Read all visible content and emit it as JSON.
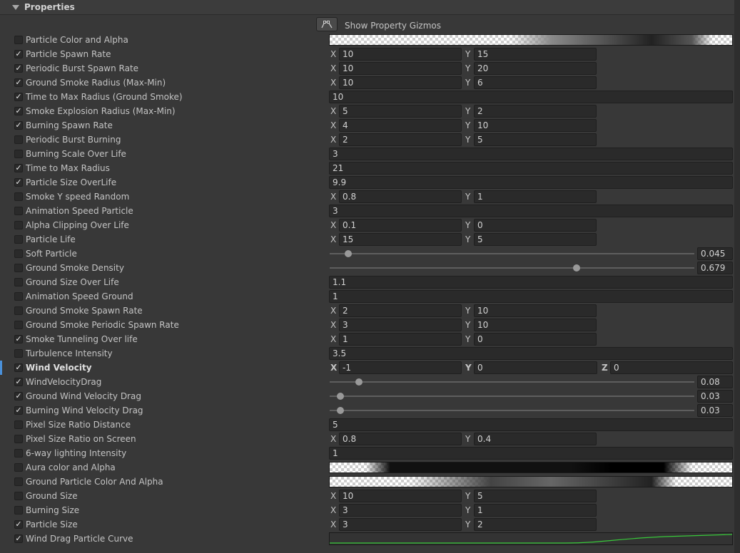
{
  "header": {
    "title": "Properties"
  },
  "gizmo": {
    "label": "Show Property Gizmos",
    "icon": "gizmo-icon"
  },
  "colors": {
    "accent": "#4a90d9",
    "curve": "#38c93a",
    "check": "#e6e6e6"
  },
  "rows": [
    {
      "label": "Particle Color and Alpha",
      "checked": false,
      "type": "gradient",
      "gradient": "a"
    },
    {
      "label": "Particle Spawn Rate",
      "checked": true,
      "type": "xy",
      "x": "10",
      "y": "15"
    },
    {
      "label": "Periodic Burst Spawn Rate",
      "checked": true,
      "type": "xy",
      "x": "10",
      "y": "20"
    },
    {
      "label": "Ground Smoke Radius (Max-Min)",
      "checked": true,
      "type": "xy",
      "x": "10",
      "y": "6"
    },
    {
      "label": "Time to Max Radius (Ground Smoke)",
      "checked": true,
      "type": "float",
      "value": "10"
    },
    {
      "label": "Smoke Explosion Radius (Max-Min)",
      "checked": true,
      "type": "xy",
      "x": "5",
      "y": "2"
    },
    {
      "label": "Burning Spawn Rate",
      "checked": true,
      "type": "xy",
      "x": "4",
      "y": "10"
    },
    {
      "label": "Periodic Burst Burning",
      "checked": false,
      "type": "xy",
      "x": "2",
      "y": "5"
    },
    {
      "label": "Burning Scale Over Life",
      "checked": false,
      "type": "float",
      "value": "3"
    },
    {
      "label": "Time to Max Radius",
      "checked": true,
      "type": "float",
      "value": "21"
    },
    {
      "label": "Particle Size OverLife",
      "checked": true,
      "type": "float",
      "value": "9.9"
    },
    {
      "label": "Smoke Y speed Random",
      "checked": false,
      "type": "xy",
      "x": "0.8",
      "y": "1"
    },
    {
      "label": "Animation Speed Particle",
      "checked": false,
      "type": "float",
      "value": "3"
    },
    {
      "label": "Alpha Clipping Over Life",
      "checked": false,
      "type": "xy",
      "x": "0.1",
      "y": "0"
    },
    {
      "label": "Particle Life",
      "checked": false,
      "type": "xy",
      "x": "15",
      "y": "5"
    },
    {
      "label": "Soft Particle",
      "checked": false,
      "type": "slider",
      "value": "0.045",
      "fraction": 0.05
    },
    {
      "label": "Ground Smoke Density",
      "checked": false,
      "type": "slider",
      "value": "0.679",
      "fraction": 0.678
    },
    {
      "label": "Ground Size Over Life",
      "checked": false,
      "type": "float",
      "value": "1.1"
    },
    {
      "label": "Animation Speed Ground",
      "checked": false,
      "type": "float",
      "value": "1"
    },
    {
      "label": "Ground Smoke Spawn Rate",
      "checked": false,
      "type": "xy",
      "x": "2",
      "y": "10"
    },
    {
      "label": "Ground Smoke Periodic Spawn Rate",
      "checked": false,
      "type": "xy",
      "x": "3",
      "y": "10"
    },
    {
      "label": "Smoke Tunneling Over life",
      "checked": true,
      "type": "xy",
      "x": "1",
      "y": "0"
    },
    {
      "label": "Turbulence Intensity",
      "checked": false,
      "type": "float",
      "value": "3.5"
    },
    {
      "label": "Wind Velocity",
      "checked": true,
      "type": "xyz",
      "x": "-1",
      "y": "0",
      "z": "0",
      "bold": true,
      "selected": true
    },
    {
      "label": "WindVelocityDrag",
      "checked": true,
      "type": "slider",
      "value": "0.08",
      "fraction": 0.08
    },
    {
      "label": "Ground Wind Velocity Drag",
      "checked": true,
      "type": "slider",
      "value": "0.03",
      "fraction": 0.03
    },
    {
      "label": "Burning Wind Velocity Drag",
      "checked": true,
      "type": "slider",
      "value": "0.03",
      "fraction": 0.03
    },
    {
      "label": "Pixel Size Ratio Distance",
      "checked": false,
      "type": "float",
      "value": "5"
    },
    {
      "label": "Pixel Size Ratio on Screen",
      "checked": false,
      "type": "xy",
      "x": "0.8",
      "y": "0.4"
    },
    {
      "label": "6-way lighting Intensity",
      "checked": false,
      "type": "float",
      "value": "1"
    },
    {
      "label": "Aura color and Alpha",
      "checked": false,
      "type": "gradient",
      "gradient": "b"
    },
    {
      "label": "Ground Particle Color And Alpha",
      "checked": false,
      "type": "gradient",
      "gradient": "c"
    },
    {
      "label": "Ground Size",
      "checked": false,
      "type": "xy",
      "x": "10",
      "y": "5"
    },
    {
      "label": "Burning Size",
      "checked": false,
      "type": "xy",
      "x": "3",
      "y": "1"
    },
    {
      "label": "Particle Size",
      "checked": true,
      "type": "xy",
      "x": "3",
      "y": "2"
    },
    {
      "label": "Wind Drag Particle Curve",
      "checked": true,
      "type": "curve"
    }
  ]
}
